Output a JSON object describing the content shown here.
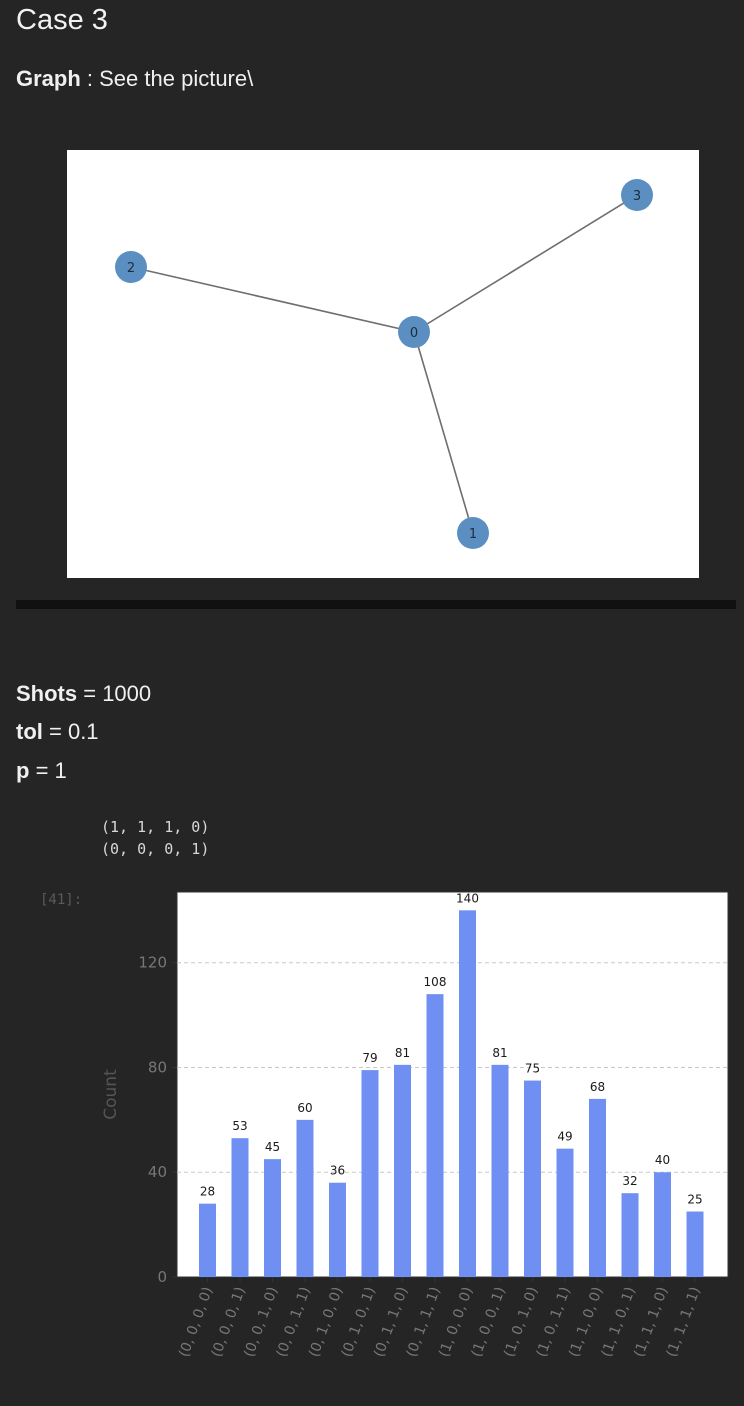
{
  "cell_heading": "Case 3",
  "graph_line": {
    "label": "Graph",
    "text": " : See the picture\\"
  },
  "graph_picture": {
    "nodes": [
      {
        "id": "0",
        "label": "0"
      },
      {
        "id": "1",
        "label": "1"
      },
      {
        "id": "2",
        "label": "2"
      },
      {
        "id": "3",
        "label": "3"
      }
    ],
    "edges": [
      [
        "0",
        "1"
      ],
      [
        "0",
        "2"
      ],
      [
        "0",
        "3"
      ]
    ],
    "node_color": "#5b8fc2"
  },
  "params": [
    {
      "label": "Shots",
      "value": " = 1000"
    },
    {
      "label": "tol",
      "value": " = 0.1"
    },
    {
      "label": "p",
      "value": " = 1"
    }
  ],
  "output_lines": [
    "(1, 1, 1, 0)",
    "(0, 0, 0, 1)"
  ],
  "execution_prompt": "[41]:",
  "chart_data": {
    "type": "bar",
    "categories": [
      "(0, 0, 0, 0)",
      "(0, 0, 0, 1)",
      "(0, 0, 1, 0)",
      "(0, 0, 1, 1)",
      "(0, 1, 0, 0)",
      "(0, 1, 0, 1)",
      "(0, 1, 1, 0)",
      "(0, 1, 1, 1)",
      "(1, 0, 0, 0)",
      "(1, 0, 0, 1)",
      "(1, 0, 1, 0)",
      "(1, 0, 1, 1)",
      "(1, 1, 0, 0)",
      "(1, 1, 0, 1)",
      "(1, 1, 1, 0)",
      "(1, 1, 1, 1)"
    ],
    "values": [
      28,
      53,
      45,
      60,
      36,
      79,
      81,
      108,
      140,
      81,
      75,
      49,
      68,
      32,
      40,
      25
    ],
    "value_labels": [
      "28",
      "53",
      "45",
      "60",
      "36",
      "79",
      "81",
      "108",
      "140",
      "81",
      "75",
      "49",
      "68",
      "32",
      "40",
      "25"
    ],
    "ylabel": "Count",
    "yticks": [
      "0",
      "40",
      "80",
      "120"
    ],
    "ytick_values": [
      0,
      40,
      80,
      120
    ],
    "ylim": [
      0,
      147
    ],
    "grid": "horizontal dashed",
    "bar_color": "#6f8ff3"
  }
}
